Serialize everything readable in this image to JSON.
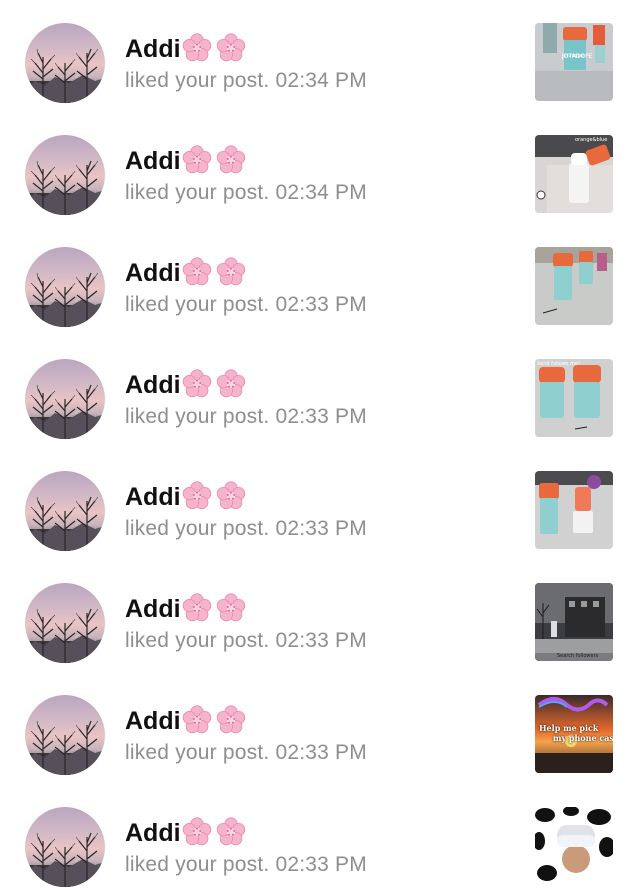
{
  "notifications": [
    {
      "user": "Addi",
      "action_time": "liked your post. 02:34 PM",
      "thumb": "bottle-gray",
      "thumb_labels": [
        "Jotadope"
      ]
    },
    {
      "user": "Addi",
      "action_time": "liked your post. 02:34 PM",
      "thumb": "bottle-white",
      "thumb_labels": [
        "orange&blue"
      ]
    },
    {
      "user": "Addi",
      "action_time": "liked your post. 02:33 PM",
      "thumb": "bottles-table",
      "thumb_labels": []
    },
    {
      "user": "Addi",
      "action_time": "liked your post. 02:33 PM",
      "thumb": "bottles-pair",
      "thumb_labels": [
        "Send follows me!"
      ]
    },
    {
      "user": "Addi",
      "action_time": "liked your post. 02:33 PM",
      "thumb": "bottles-mint",
      "thumb_labels": []
    },
    {
      "user": "Addi",
      "action_time": "liked your post. 02:33 PM",
      "thumb": "street-night",
      "thumb_labels": [
        "Search followers"
      ]
    },
    {
      "user": "Addi",
      "action_time": "liked your post. 02:33 PM",
      "thumb": "sunset",
      "thumb_labels": [
        "Help me pick",
        "my phone case"
      ]
    },
    {
      "user": "Addi",
      "action_time": "liked your post. 02:33 PM",
      "thumb": "cow-print",
      "thumb_labels": []
    }
  ],
  "icons": {
    "avatar": "sunset-trees-avatar",
    "name_emoji": "cherry-blossom-icon"
  },
  "colors": {
    "name": "#111111",
    "subtext": "#8e8e8e",
    "background": "#ffffff"
  }
}
